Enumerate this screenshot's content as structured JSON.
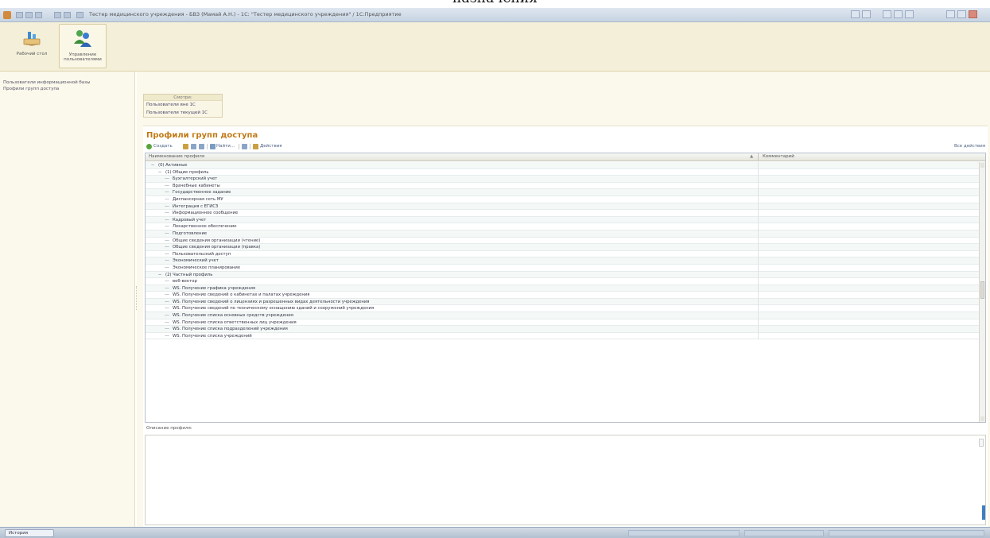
{
  "caption_fragment": "назначения",
  "window": {
    "title": "Тестер медицинского учреждения - БВЗ (Мамай А.Н.) - 1С: \"Тестер медицинского учреждения\" / 1С:Предприятие"
  },
  "ribbon": {
    "buttons": [
      {
        "label": "Рабочий стол",
        "active": false
      },
      {
        "label": "Управление пользователями",
        "active": true
      }
    ]
  },
  "sidebar": {
    "items": [
      {
        "label": "Пользователи информационной базы"
      },
      {
        "label": "Профили групп доступа"
      }
    ]
  },
  "see_also": {
    "title": "Смотри:",
    "links": [
      {
        "label": "Пользователи вне 1С"
      },
      {
        "label": "Пользователи текущей 1С"
      }
    ]
  },
  "form": {
    "title": "Профили групп доступа",
    "toolbar": {
      "create": "Создать",
      "find": "Найти...",
      "actions": "Действия",
      "all_actions": "Все действия"
    },
    "columns": {
      "name": "Наименование профиля",
      "comment": "Комментарий"
    },
    "rows": [
      {
        "level": 0,
        "toggle": "−",
        "label": "(0) Активные"
      },
      {
        "level": 1,
        "toggle": "−",
        "label": "(1) Общие профиль"
      },
      {
        "level": 2,
        "toggle": "",
        "label": "Бухгалтерский учет"
      },
      {
        "level": 2,
        "toggle": "",
        "label": "Врачебные кабинеты"
      },
      {
        "level": 2,
        "toggle": "",
        "label": "Государственное задание"
      },
      {
        "level": 2,
        "toggle": "",
        "label": "Диспансерная сеть МУ"
      },
      {
        "level": 2,
        "toggle": "",
        "label": "Интеграция с ЕГИСЗ"
      },
      {
        "level": 2,
        "toggle": "",
        "label": "Информационное сообщение"
      },
      {
        "level": 2,
        "toggle": "",
        "label": "Кадровый учет"
      },
      {
        "level": 2,
        "toggle": "",
        "label": "Лекарственное обеспечение"
      },
      {
        "level": 2,
        "toggle": "",
        "label": "Подготовление"
      },
      {
        "level": 2,
        "toggle": "",
        "label": "Общие сведения организации (чтение)"
      },
      {
        "level": 2,
        "toggle": "",
        "label": "Общие сведения организации (правка)"
      },
      {
        "level": 2,
        "toggle": "",
        "label": "Пользовательский доступ"
      },
      {
        "level": 2,
        "toggle": "",
        "label": "Экономический учет"
      },
      {
        "level": 2,
        "toggle": "",
        "label": "Экономическое планирование"
      },
      {
        "level": 1,
        "toggle": "−",
        "label": "(2) Частный профиль"
      },
      {
        "level": 2,
        "toggle": "",
        "label": "веб-вектор"
      },
      {
        "level": 2,
        "toggle": "",
        "label": "WS. Получение графика учреждения"
      },
      {
        "level": 2,
        "toggle": "",
        "label": "WS. Получение сведений о кабинетах и палатах учреждения"
      },
      {
        "level": 2,
        "toggle": "",
        "label": "WS. Получение сведений о лицензиях и разрешенных видах деятельности учреждения"
      },
      {
        "level": 2,
        "toggle": "",
        "label": "WS. Получение сведений по техническому оснащению зданий и сооружений учреждения"
      },
      {
        "level": 2,
        "toggle": "",
        "label": "WS. Получение списка основных средств учреждения"
      },
      {
        "level": 2,
        "toggle": "",
        "label": "WS. Получение списка ответственных лиц учреждения"
      },
      {
        "level": 2,
        "toggle": "",
        "label": "WS. Получение списка подразделений учреждения"
      },
      {
        "level": 2,
        "toggle": "",
        "label": "WS. Получение списка учреждений"
      }
    ],
    "description_label": "Описание профиля:"
  },
  "statusbar": {
    "history_label": "История"
  },
  "colors": {
    "accent_title": "#c17a16",
    "ribbon_bg": "#f4efd9",
    "panel_bg": "#fbf8ec",
    "row_alt": "#f4f9f7"
  }
}
